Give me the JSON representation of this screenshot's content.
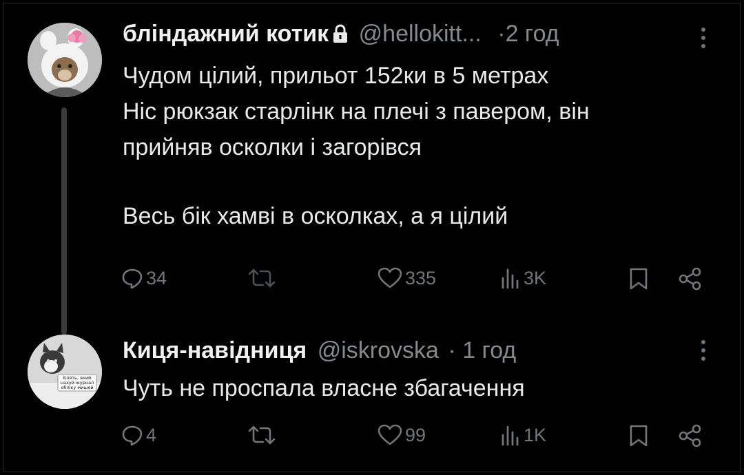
{
  "posts": [
    {
      "author_name": "бліндажний котик",
      "handle": "@hellokitt...",
      "separator": "·",
      "time": "2 год",
      "locked": true,
      "avatar_icon": "hello-kitty-cat-avatar",
      "lines": [
        "Чудом цілий, прильот 152ки в 5 метрах",
        "Ніс рюкзак старлінк на плечі з павером, він",
        "прийняв осколки і загорівся",
        "",
        "Весь бік хамві в осколках, а я цілий"
      ],
      "stats": {
        "replies": "34",
        "reposts": "",
        "likes": "335",
        "views": "3K"
      }
    },
    {
      "author_name": "Киця-навідниця",
      "handle": "@iskrovska",
      "separator": "·",
      "time": "1 год",
      "locked": false,
      "avatar_icon": "cat-meme-avatar",
      "avatar_caption": "Блять, який нахуй журнал обліку мишей",
      "lines": [
        "Чуть не проспала власне збагачення"
      ],
      "stats": {
        "replies": "4",
        "reposts": "",
        "likes": "99",
        "views": "1K"
      }
    }
  ],
  "colors": {
    "background": "#000000",
    "text": "#e7e9ea",
    "muted": "#71767b",
    "thread_line": "#3a3a3a"
  }
}
